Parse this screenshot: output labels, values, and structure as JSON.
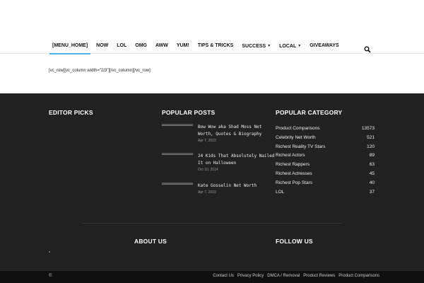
{
  "nav": {
    "items": [
      {
        "label": "[MENU_HOME]"
      },
      {
        "label": "NOW"
      },
      {
        "label": "LOL"
      },
      {
        "label": "OMG"
      },
      {
        "label": "AWW"
      },
      {
        "label": "YUM!"
      },
      {
        "label": "TIPS & TRICKS"
      },
      {
        "label": "SUCCESS"
      },
      {
        "label": "LOCAL"
      },
      {
        "label": "GIVEAWAYS"
      }
    ],
    "search_icon": "search-icon",
    "accent_color": "#4db2ec"
  },
  "content": {
    "shortcode_text": "[vc_row][vc_column width=\"2/3\"][/vc_column][/vc_row]"
  },
  "footer": {
    "editor_picks_title": "EDITOR PICKS",
    "popular_posts_title": "POPULAR POSTS",
    "popular_category_title": "POPULAR CATEGORY",
    "posts": [
      {
        "title": "Bow Wow aka Shad Moss Net Worth, Quotes & Biography",
        "date": "Apr 7, 2015"
      },
      {
        "title": "24 Kids That Absolutely Nailed It on Halloween",
        "date": "Oct 10, 2014"
      },
      {
        "title": "Kate Gosselin Net Worth",
        "date": "Apr 7, 2015"
      }
    ],
    "categories": [
      {
        "name": "Product Comparisons",
        "count": "13573"
      },
      {
        "name": "Celebrity Net Worth",
        "count": "521"
      },
      {
        "name": "Richest Reality TV Stars",
        "count": "120"
      },
      {
        "name": "Richest Actors",
        "count": "89"
      },
      {
        "name": "Richest Rappers",
        "count": "63"
      },
      {
        "name": "Richest Actresses",
        "count": "45"
      },
      {
        "name": "Richest Pop Stars",
        "count": "40"
      },
      {
        "name": "LOL",
        "count": "37"
      }
    ],
    "about_title": "ABOUT US",
    "follow_title": "FOLLOW US"
  },
  "bottom_bar": {
    "copyright": "©",
    "links": [
      {
        "label": "Contact Us"
      },
      {
        "label": "Privacy Policy"
      },
      {
        "label": "DMCA / Removal"
      },
      {
        "label": "Product Reviews"
      },
      {
        "label": "Product Comparisons"
      }
    ]
  }
}
